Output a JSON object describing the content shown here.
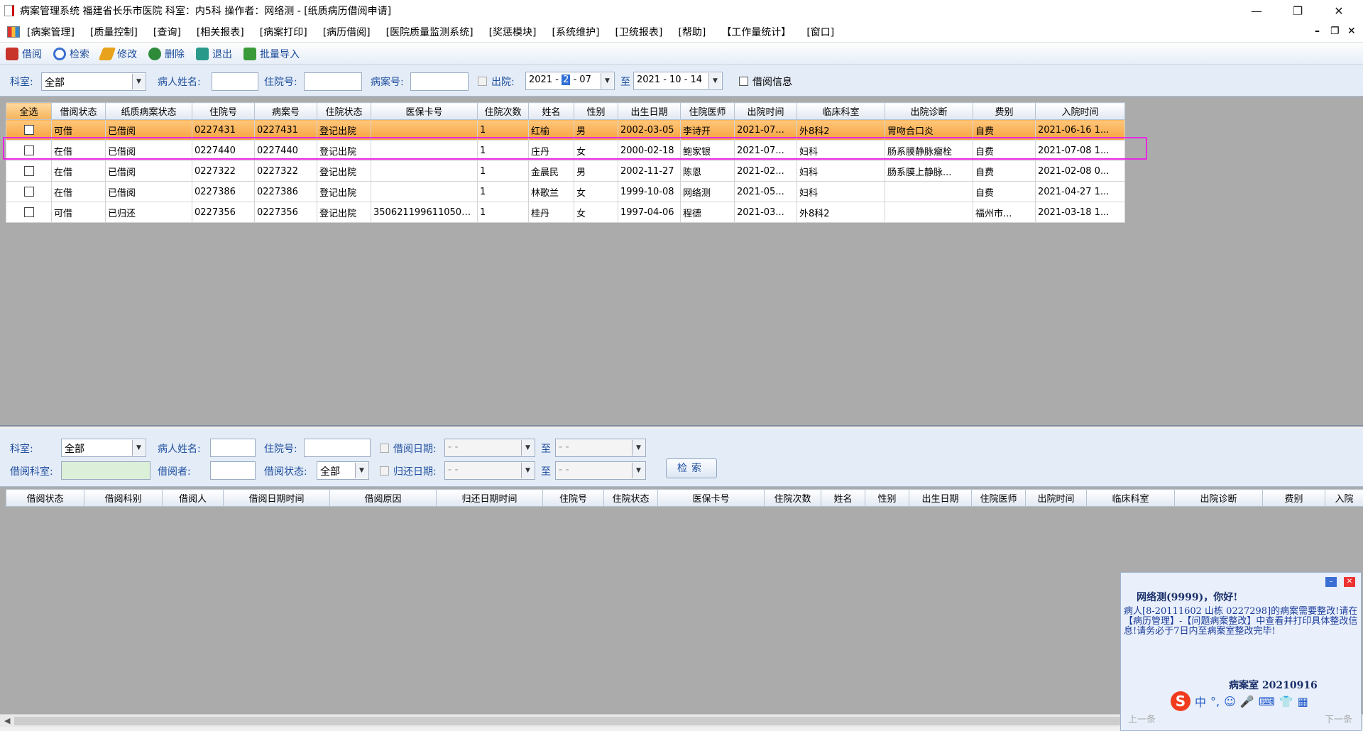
{
  "window": {
    "title": "病案管理系统  福建省长乐市医院  科室：内5科 操作者：网络测 - [纸质病历借阅申请]",
    "controls": [
      "—",
      "❐",
      "✕"
    ]
  },
  "menubar": {
    "items": [
      "[病案管理]",
      "[质量控制]",
      "[查询]",
      "[相关报表]",
      "[病案打印]",
      "[病历借阅]",
      "[医院质量监测系统]",
      "[奖惩模块]",
      "[系统维护]",
      "[卫统报表]",
      "[帮助]",
      "【工作量统计】",
      "[窗口]"
    ],
    "mdi_controls": [
      "–",
      "❐",
      "✕"
    ]
  },
  "toolbar": {
    "buttons": [
      {
        "label": "借阅",
        "icon": "borrow-icon",
        "color": "#c8332a"
      },
      {
        "label": "检索",
        "icon": "search-icon",
        "color": "#3a6fd0"
      },
      {
        "label": "修改",
        "icon": "edit-icon",
        "color": "#e8a21b"
      },
      {
        "label": "删除",
        "icon": "delete-icon",
        "color": "#2e8b3a"
      },
      {
        "label": "退出",
        "icon": "exit-icon",
        "color": "#2a9a8a"
      },
      {
        "label": "批量导入",
        "icon": "import-icon",
        "color": "#3a9a3a"
      }
    ]
  },
  "filter1": {
    "dept_label": "科室:",
    "dept_value": "全部",
    "name_label": "病人姓名:",
    "name_value": "",
    "inpatient_label": "住院号:",
    "inpatient_value": "",
    "case_label": "病案号:",
    "case_value": "",
    "discharge_label": "出院:",
    "date_from_year": "2021 -",
    "date_from_month": "2",
    "date_from_day": "- 07",
    "to_label": "至",
    "date_to": "2021 - 10 - 14",
    "borrow_info_label": "借阅信息"
  },
  "grid1": {
    "columns": [
      "全选",
      "借阅状态",
      "纸质病案状态",
      "住院号",
      "病案号",
      "住院状态",
      "医保卡号",
      "住院次数",
      "姓名",
      "性别",
      "出生日期",
      "住院医师",
      "出院时间",
      "临床科室",
      "出院诊断",
      "费别",
      "入院时间"
    ],
    "rows": [
      [
        "",
        "可借",
        "已借阅",
        "0227431",
        "0227431",
        "登记出院",
        "",
        "1",
        "红榆",
        "男",
        "2002-03-05",
        "李诗开",
        "2021-07...",
        "外8科2",
        "胃吻合口炎",
        "自费",
        "2021-06-16 1..."
      ],
      [
        "",
        "在借",
        "已借阅",
        "0227440",
        "0227440",
        "登记出院",
        "",
        "1",
        "庄丹",
        "女",
        "2000-02-18",
        "鲍家银",
        "2021-07...",
        "妇科",
        "肠系膜静脉瘤栓",
        "自费",
        "2021-07-08 1..."
      ],
      [
        "",
        "在借",
        "已借阅",
        "0227322",
        "0227322",
        "登记出院",
        "",
        "1",
        "金晨民",
        "男",
        "2002-11-27",
        "陈恩",
        "2021-02...",
        "妇科",
        "肠系膜上静脉...",
        "自费",
        "2021-02-08 0..."
      ],
      [
        "",
        "在借",
        "已借阅",
        "0227386",
        "0227386",
        "登记出院",
        "",
        "1",
        "林歌兰",
        "女",
        "1999-10-08",
        "网络测",
        "2021-05...",
        "妇科",
        "",
        "自费",
        "2021-04-27 1..."
      ],
      [
        "",
        "可借",
        "已归还",
        "0227356",
        "0227356",
        "登记出院",
        "3506211996110500...",
        "1",
        "桂丹",
        "女",
        "1997-04-06",
        "程德",
        "2021-03...",
        "外8科2",
        "",
        "福州市...",
        "2021-03-18 1..."
      ]
    ]
  },
  "filter2": {
    "dept_label": "科室:",
    "dept_value": "全部",
    "name_label": "病人姓名:",
    "name_value": "",
    "inpatient_label": "住院号:",
    "inpatient_value": "",
    "borrow_date_label": "借阅日期:",
    "borrow_date_from": "-    -",
    "to_label": "至",
    "borrow_date_to": "-    -",
    "borrow_dept_label": "借阅科室:",
    "borrow_dept_value": "",
    "borrower_label": "借阅者:",
    "borrower_value": "",
    "status_label": "借阅状态:",
    "status_value": "全部",
    "return_date_label": "归还日期:",
    "return_date_from": "-    -",
    "return_date_to": "-    -",
    "search_label": "检索"
  },
  "grid2": {
    "columns": [
      "借阅状态",
      "借阅科别",
      "借阅人",
      "借阅日期时间",
      "借阅原因",
      "归还日期时间",
      "住院号",
      "住院状态",
      "医保卡号",
      "住院次数",
      "姓名",
      "性别",
      "出生日期",
      "住院医师",
      "出院时间",
      "临床科室",
      "出院诊断",
      "费别",
      "入院"
    ]
  },
  "notification": {
    "greeting": "网络测(9999)，你好!",
    "message": "病人[8-20111602   山栋   0227298]的病案需要整改!请在【病历管理】-【问题病案整改】中查看并打印具体整改信息!请务必于7日内至病案室整改完毕!",
    "signature": "病案室  20210916",
    "prev": "上一条",
    "next": "下一条",
    "ime_glyphs": [
      "中",
      "°,",
      "☺",
      "🎤",
      "⌨",
      "👕",
      "▦"
    ]
  }
}
